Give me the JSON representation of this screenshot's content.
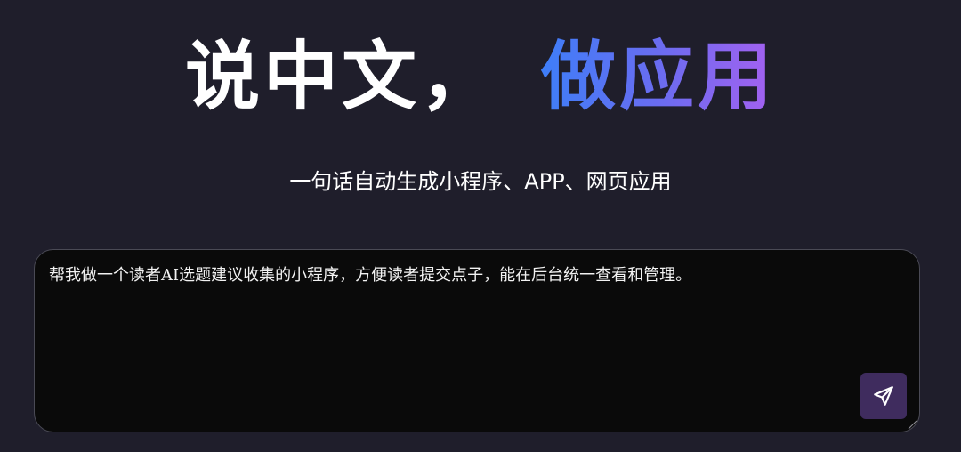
{
  "hero": {
    "part1": "说中文，",
    "part2": "做应用",
    "gradient_colors": [
      "#3e7ef8",
      "#6a6cf0",
      "#a561f0"
    ]
  },
  "subtitle": "一句话自动生成小程序、APP、网页应用",
  "prompt": {
    "value": "帮我做一个读者AI选题建议收集的小程序，方便读者提交点子，能在后台统一查看和管理。",
    "send_icon": "send-arrow-icon"
  },
  "colors": {
    "background": "#1f1e2b",
    "input_background": "#0a0a0a",
    "send_button": "#3f2c5e"
  }
}
